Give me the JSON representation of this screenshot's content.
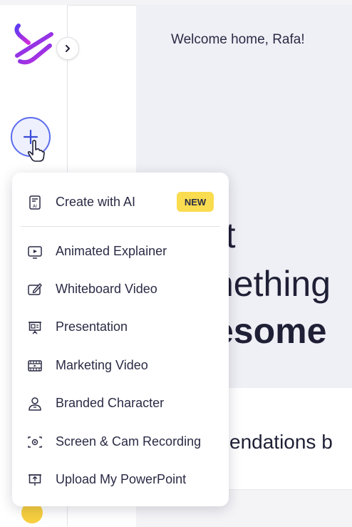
{
  "header": {
    "welcome": "Welcome home, Rafa!"
  },
  "hero": {
    "line1": "rt",
    "line2": "nething",
    "line3": "esome"
  },
  "recommendations": {
    "title": "endations b"
  },
  "menu": {
    "items": [
      {
        "label": "Create with AI",
        "icon": "ai-document-icon",
        "badge": "NEW"
      },
      {
        "label": "Animated Explainer",
        "icon": "play-screen-icon"
      },
      {
        "label": "Whiteboard Video",
        "icon": "whiteboard-pen-icon"
      },
      {
        "label": "Presentation",
        "icon": "presentation-board-icon"
      },
      {
        "label": "Marketing Video",
        "icon": "film-strip-icon"
      },
      {
        "label": "Branded Character",
        "icon": "character-icon"
      },
      {
        "label": "Screen & Cam Recording",
        "icon": "screen-record-icon"
      },
      {
        "label": "Upload My PowerPoint",
        "icon": "upload-presentation-icon"
      }
    ]
  },
  "colors": {
    "accent": "#5b6cf0",
    "badge": "#f9dc4f",
    "hero_bg": "#eff0f5"
  }
}
